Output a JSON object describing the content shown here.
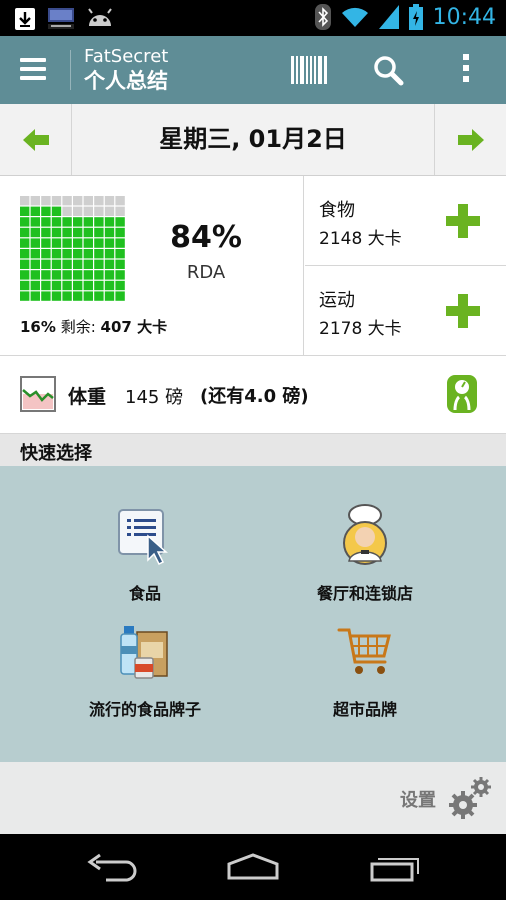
{
  "status_bar": {
    "time": "10:44",
    "icons": [
      "download-icon",
      "panasonic-icon",
      "android-icon",
      "bluetooth-icon",
      "wifi-icon",
      "signal-icon",
      "battery-icon"
    ]
  },
  "action_bar": {
    "app_name": "FatSecret",
    "subtitle": "个人总结"
  },
  "date_nav": {
    "label": "星期三, 01月2日"
  },
  "summary": {
    "rda_percent": "84%",
    "rda_label": "RDA",
    "rda_fraction": 0.84,
    "remaining_percent": "16%",
    "remaining_label": "剩余:",
    "remaining_value": "407 大卡"
  },
  "food": {
    "title": "食物",
    "value": "2148 大卡"
  },
  "exercise": {
    "title": "运动",
    "value": "2178 大卡"
  },
  "weight": {
    "label": "体重",
    "value": "145 磅",
    "remaining": "(还有4.0 磅)"
  },
  "quick_select": {
    "title": "快速选择",
    "items": [
      {
        "label": "食品"
      },
      {
        "label": "餐厅和连锁店"
      },
      {
        "label": "流行的食品牌子"
      },
      {
        "label": "超市品牌"
      }
    ]
  },
  "settings": {
    "label": "设置"
  },
  "colors": {
    "accent": "#5f8d96",
    "green": "#1fc01f",
    "clock": "#33b5e5"
  }
}
